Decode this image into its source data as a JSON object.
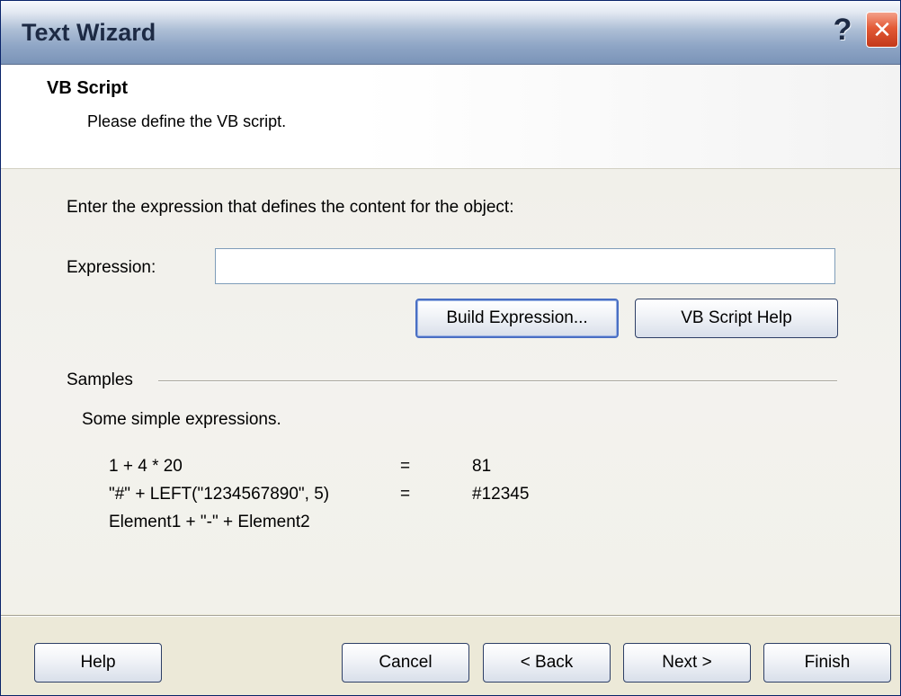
{
  "window": {
    "title": "Text Wizard",
    "help_glyph": "?",
    "close_glyph": "✕"
  },
  "header": {
    "title": "VB Script",
    "subtitle": "Please define the VB script."
  },
  "main": {
    "prompt": "Enter the expression that defines the content for the object:",
    "expression_label": "Expression:",
    "expression_value": "",
    "build_button": "Build Expression...",
    "help_button": "VB Script Help"
  },
  "samples": {
    "label": "Samples",
    "intro": "Some simple expressions.",
    "rows": [
      {
        "expr": "1 + 4 * 20",
        "eq": "=",
        "result": "81"
      },
      {
        "expr": "\"#\" + LEFT(\"1234567890\", 5)",
        "eq": "=",
        "result": "#12345"
      },
      {
        "expr": "Element1 + \"-\" + Element2",
        "eq": "",
        "result": ""
      }
    ]
  },
  "footer": {
    "help": "Help",
    "cancel": "Cancel",
    "back": "< Back",
    "next": "Next >",
    "finish": "Finish"
  },
  "colors": {
    "titlebar_text": "#1d2a44",
    "close_button": "#e35a36",
    "focus_border": "#4a6fc3"
  }
}
